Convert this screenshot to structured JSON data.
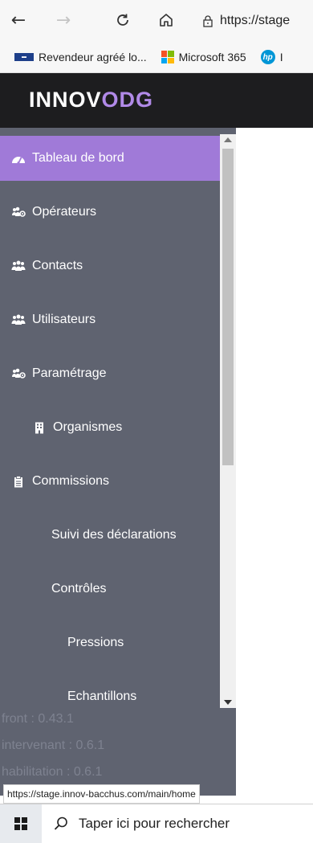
{
  "browser": {
    "address_url": "https://stage",
    "bookmarks": [
      {
        "label": "Revendeur agréé lo..."
      },
      {
        "label": "Microsoft 365"
      },
      {
        "label": "I"
      }
    ],
    "status_url": "https://stage.innov-bacchus.com/main/home"
  },
  "app": {
    "brand_part1": "INNOV",
    "brand_part2": "ODG",
    "brand_accent": "#b18ae8"
  },
  "sidebar": {
    "items": [
      {
        "label": "Tableau de bord",
        "icon": "dashboard-icon",
        "active": true
      },
      {
        "label": "Opérateurs",
        "icon": "users-cog-icon"
      },
      {
        "label": "Contacts",
        "icon": "users-icon"
      },
      {
        "label": "Utilisateurs",
        "icon": "users-icon"
      },
      {
        "label": "Paramétrage",
        "icon": "users-cog-icon"
      },
      {
        "label": "Organismes",
        "icon": "building-icon"
      },
      {
        "label": "Commissions",
        "icon": "clipboard-icon"
      },
      {
        "label": "Suivi des déclarations"
      },
      {
        "label": "Contrôles"
      },
      {
        "label": "Pressions"
      },
      {
        "label": "Echantillons"
      }
    ],
    "versions": [
      "front : 0.43.1",
      "intervenant : 0.6.1",
      "habilitation : 0.6.1"
    ]
  },
  "taskbar": {
    "search_placeholder": "Taper ici pour rechercher"
  },
  "colors": {
    "sidebar_bg": "#5f6370",
    "active_item": "#a07ad8",
    "header_bg": "#1d1d1f"
  }
}
